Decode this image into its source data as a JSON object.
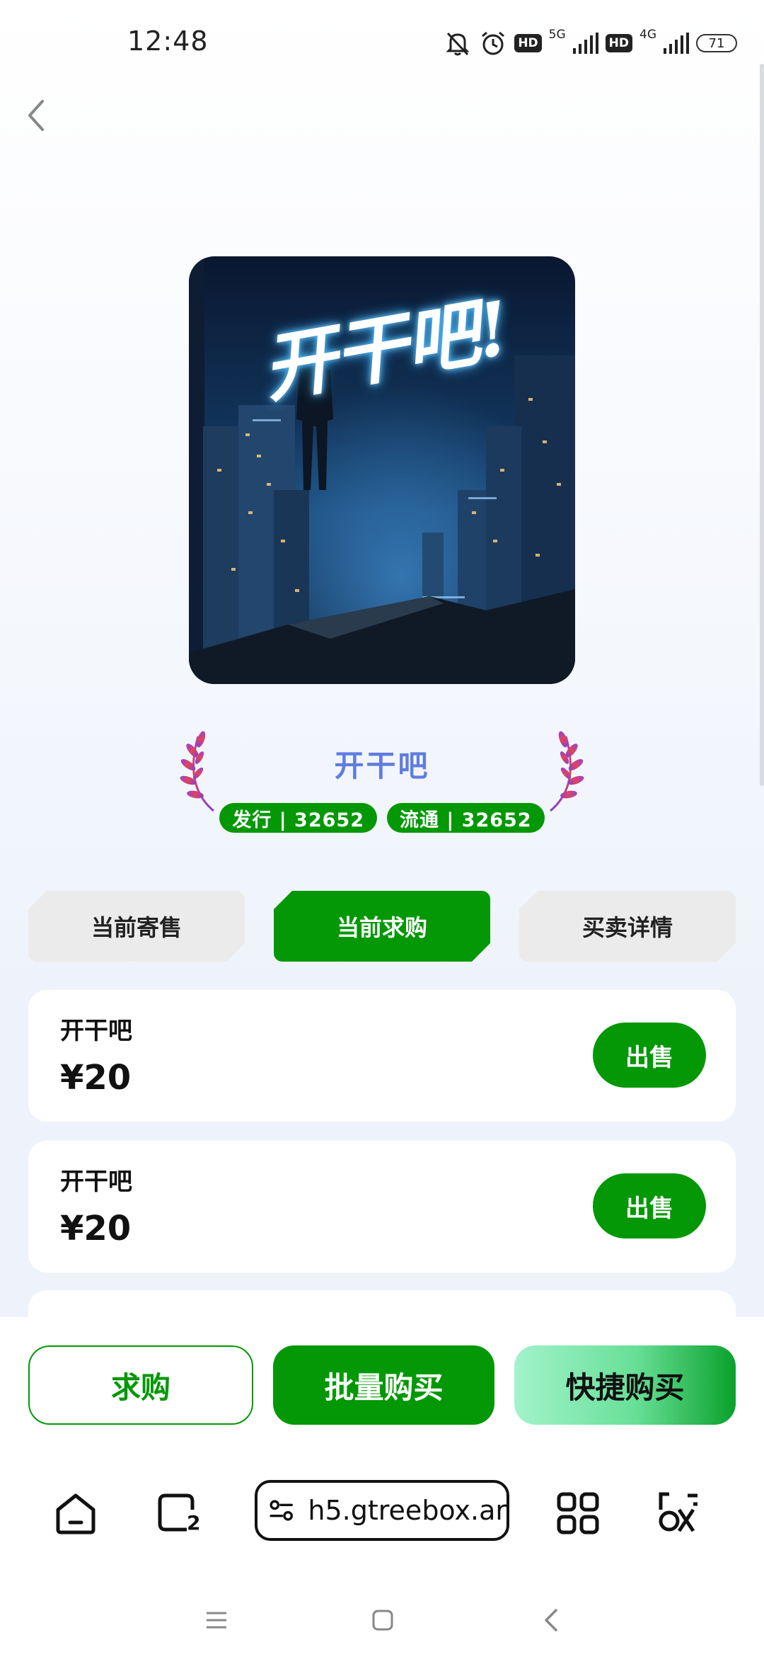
{
  "status_bar": {
    "time": "12:48",
    "net1": "5G",
    "net2": "4G",
    "hd": "HD",
    "battery": "71",
    "icons": [
      "bell-off-icon",
      "alarm-icon",
      "signal-icon",
      "battery-icon"
    ]
  },
  "header": {
    "back_icon": "chevron-left-icon"
  },
  "cover": {
    "art_text": "开干吧!"
  },
  "item": {
    "title": "开干吧",
    "issue_badge": "发行 | 32652",
    "circulation_badge": "流通 | 32652"
  },
  "tabs": [
    {
      "label": "当前寄售",
      "active": false
    },
    {
      "label": "当前求购",
      "active": true
    },
    {
      "label": "买卖详情",
      "active": false
    }
  ],
  "listings": [
    {
      "name": "开干吧",
      "price": "¥20",
      "action": "出售"
    },
    {
      "name": "开干吧",
      "price": "¥20",
      "action": "出售"
    }
  ],
  "actions": {
    "want": "求购",
    "bulk_buy": "批量购买",
    "quick_buy": "快捷购买"
  },
  "browser": {
    "url": "h5.gtreebox.ar",
    "tab_count": "2",
    "icons": [
      "home-icon",
      "tabs-icon",
      "site-settings-icon",
      "apps-grid-icon",
      "menu-icon"
    ]
  },
  "colors": {
    "accent": "#049806",
    "title": "#5f7de0"
  }
}
